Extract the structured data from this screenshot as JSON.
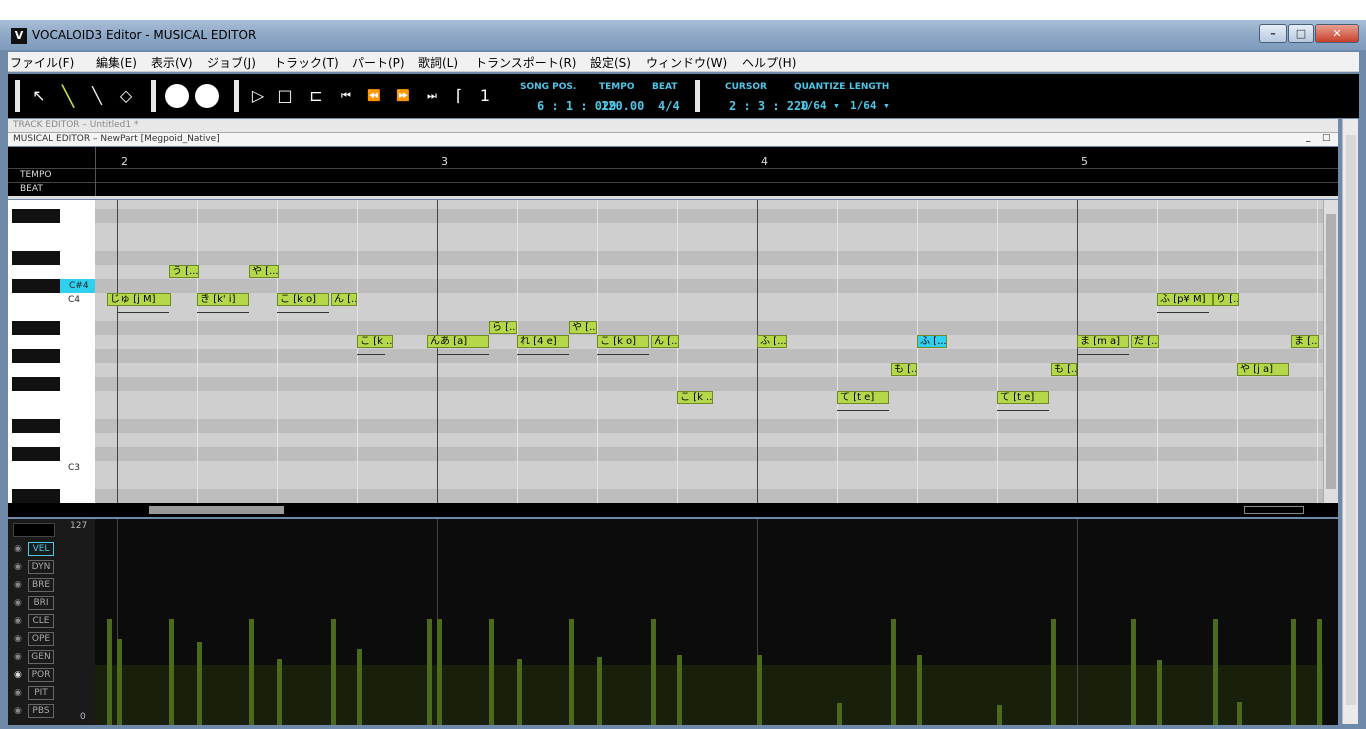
{
  "window": {
    "app_icon": "V",
    "title": "VOCALOID3 Editor - MUSICAL EDITOR",
    "minimize": "–",
    "maximize": "□",
    "close": "✕"
  },
  "menu": [
    "ファイル(F)",
    "編集(E)",
    "表示(V)",
    "ジョブ(J)",
    "トラック(T)",
    "パート(P)",
    "歌詞(L)",
    "トランスポート(R)",
    "設定(S)",
    "ウィンドウ(W)",
    "ヘルプ(H)"
  ],
  "toolbar": {
    "tools": [
      {
        "name": "arrow-tool",
        "glyph": "↖"
      },
      {
        "name": "pencil-tool",
        "glyph": "╲"
      },
      {
        "name": "line-tool",
        "glyph": "╲"
      },
      {
        "name": "eraser-tool",
        "glyph": "◇"
      }
    ],
    "transport": [
      {
        "name": "play",
        "glyph": "▷"
      },
      {
        "name": "stop",
        "glyph": "□"
      },
      {
        "name": "loop",
        "glyph": "⊏"
      },
      {
        "name": "to-start",
        "glyph": "⏮"
      },
      {
        "name": "rewind",
        "glyph": "⏪"
      },
      {
        "name": "fast-forward",
        "glyph": "⏩"
      },
      {
        "name": "to-end",
        "glyph": "⏭"
      }
    ],
    "song_pos_label": "SONG POS.",
    "song_pos": "6 : 1 : 029",
    "tempo_label": "TEMPO",
    "tempo": "120.00",
    "beat_label": "BEAT",
    "beat": "4/4",
    "cursor_label": "CURSOR",
    "cursor": "2 : 3 : 220",
    "quantize_label": "QUANTIZE",
    "quantize": "1/64 ▾",
    "length_label": "LENGTH",
    "length": "1/64 ▾"
  },
  "track_editor_label": "TRACK EDITOR – Untitled1 *",
  "musical_editor_label": "MUSICAL EDITOR – NewPart [Megpoid_Native]",
  "ruler": {
    "tempo_label": "TEMPO",
    "beat_label": "BEAT",
    "measures": [
      "2",
      "3",
      "4",
      "5"
    ]
  },
  "keys": {
    "highlight": "C#4",
    "c4": "C4",
    "c3": "C3"
  },
  "notes": [
    {
      "lyric": "う [..."
    },
    {
      "lyric": "や [..."
    },
    {
      "lyric": "じゅ [j M]"
    },
    {
      "lyric": "き [k' i]"
    },
    {
      "lyric": "こ [k o]"
    },
    {
      "lyric": "ん [..."
    },
    {
      "lyric": "ら [..."
    },
    {
      "lyric": "や [..."
    },
    {
      "lyric": "こ [k ..."
    },
    {
      "lyric": "んあ [a]"
    },
    {
      "lyric": "れ [4 e]"
    },
    {
      "lyric": "こ [k o]"
    },
    {
      "lyric": "ん [..."
    },
    {
      "lyric": "ふ [..."
    },
    {
      "lyric": "ふ [..."
    },
    {
      "lyric": "ま [m a]"
    },
    {
      "lyric": "だ [..."
    },
    {
      "lyric": "ま [..."
    },
    {
      "lyric": "も [..."
    },
    {
      "lyric": "も [..."
    },
    {
      "lyric": "や [j a]"
    },
    {
      "lyric": "ふ [p¥ M]"
    },
    {
      "lyric": "り [..."
    },
    {
      "lyric": "こ [k ..."
    },
    {
      "lyric": "て [t e]"
    },
    {
      "lyric": "て [t e]"
    }
  ],
  "control": {
    "max": "127",
    "min": "0",
    "params": [
      "VEL",
      "DYN",
      "BRE",
      "BRI",
      "CLE",
      "OPE",
      "GEN",
      "POR",
      "PIT",
      "PBS"
    ],
    "active": "VEL"
  }
}
